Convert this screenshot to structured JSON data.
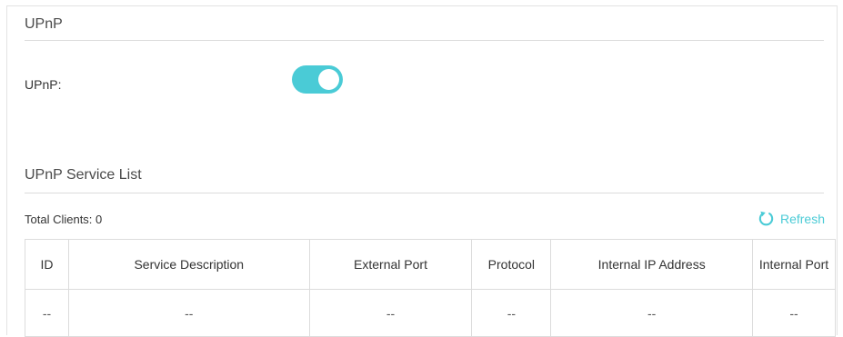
{
  "upnp": {
    "section_title": "UPnP",
    "toggle_label": "UPnP:",
    "toggle_enabled": true
  },
  "service_list": {
    "section_title": "UPnP Service List",
    "total_clients": "Total Clients: 0",
    "refresh_label": "Refresh",
    "refresh_icon": "refresh-icon",
    "columns": [
      "ID",
      "Service Description",
      "External Port",
      "Protocol",
      "Internal IP Address",
      "Internal Port"
    ],
    "rows": [
      [
        "--",
        "--",
        "--",
        "--",
        "--",
        "--"
      ]
    ]
  },
  "colors": {
    "accent": "#4acbd6",
    "divider": "#dcdcdc"
  }
}
